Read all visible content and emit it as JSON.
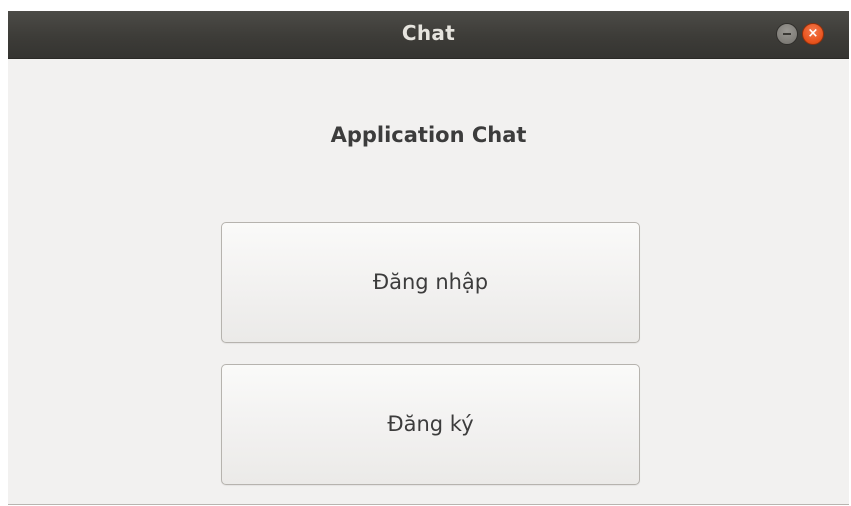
{
  "window": {
    "title": "Chat",
    "controls": {
      "minimize_icon": "minimize-icon",
      "close_icon": "close-icon",
      "close_glyph": "×"
    }
  },
  "main": {
    "heading": "Application Chat",
    "login_label": "Đăng nhập",
    "register_label": "Đăng ký"
  },
  "colors": {
    "titlebar": "#3d3c38",
    "window_bg": "#f2f1f0",
    "close_button": "#e9541e",
    "text": "#3c3c3c"
  }
}
